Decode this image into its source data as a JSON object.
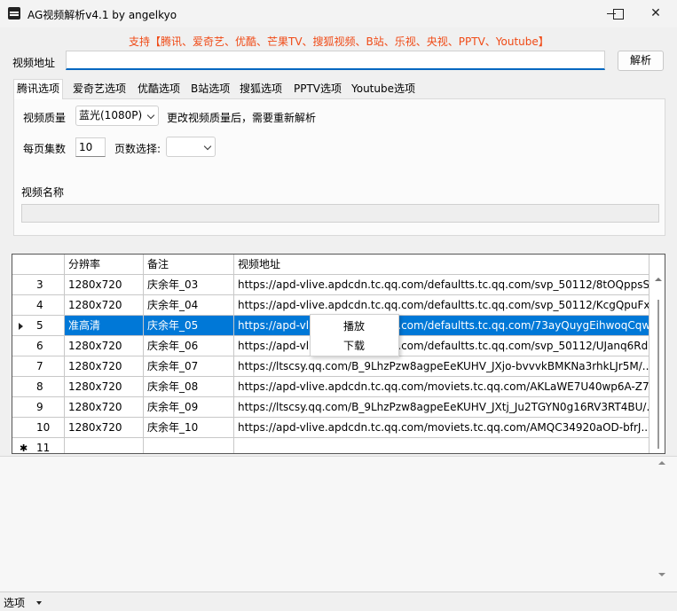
{
  "window": {
    "title": "AG视频解析v4.1 by angelkyo"
  },
  "support_text": "支持【腾讯、爱奇艺、优酷、芒果TV、搜狐视频、B站、乐视、央视、PPTV、Youtube】",
  "url": {
    "label": "视频地址",
    "value": ""
  },
  "parse_button": "解析",
  "tabs": [
    "腾讯选项",
    "爱奇艺选项",
    "优酷选项",
    "B站选项",
    "搜狐选项",
    "PPTV选项",
    "Youtube选项"
  ],
  "options": {
    "quality_label": "视频质量",
    "quality_value": "蓝光(1080P)",
    "quality_note": "更改视频质量后，需要重新解析",
    "per_page_label": "每页集数",
    "per_page_value": "10",
    "page_select_label": "页数选择:",
    "page_select_value": "",
    "name_label": "视频名称",
    "name_value": ""
  },
  "table": {
    "headers": [
      "分辨率",
      "备注",
      "视频地址"
    ],
    "rows": [
      {
        "no": "3",
        "res": "1280x720",
        "note": "庆余年_03",
        "url": "https://apd-vlive.apdcdn.tc.qq.com/defaultts.tc.qq.com/svp_50112/8tOQppsS..."
      },
      {
        "no": "4",
        "res": "1280x720",
        "note": "庆余年_04",
        "url": "https://apd-vlive.apdcdn.tc.qq.com/defaultts.tc.qq.com/svp_50112/KcgQpuFx..."
      },
      {
        "no": "5",
        "res": "准高清",
        "note": "庆余年_05",
        "url": "https://apd-vlive.apdcdn.tc.qq.com/defaultts.tc.qq.com/73ayQuygEihwoqCqw..."
      },
      {
        "no": "6",
        "res": "1280x720",
        "note": "庆余年_06",
        "url": "https://apd-vlive.apdcdn.tc.qq.com/defaultts.tc.qq.com/svp_50112/UJanq6Rd..."
      },
      {
        "no": "7",
        "res": "1280x720",
        "note": "庆余年_07",
        "url": "https://ltscsy.qq.com/B_9LhzPzw8agpeEeKUHV_JXjo-bvvvkBMKNa3rhkLJr5M/..."
      },
      {
        "no": "8",
        "res": "1280x720",
        "note": "庆余年_08",
        "url": "https://apd-vlive.apdcdn.tc.qq.com/moviets.tc.qq.com/AKLaWE7U40wp6A-Z7..."
      },
      {
        "no": "9",
        "res": "1280x720",
        "note": "庆余年_09",
        "url": "https://ltscsy.qq.com/B_9LhzPzw8agpeEeKUHV_JXtj_Ju2TGYN0g16RV3RT4BU/..."
      },
      {
        "no": "10",
        "res": "1280x720",
        "note": "庆余年_10",
        "url": "https://apd-vlive.apdcdn.tc.qq.com/moviets.tc.qq.com/AMQC34920aOD-bfrJ..."
      },
      {
        "no": "11",
        "res": "",
        "note": "",
        "url": ""
      }
    ]
  },
  "context_menu": [
    "播放",
    "下载"
  ],
  "status_menu": "选项",
  "colors": {
    "accent": "#0078d7",
    "support_text": "#f04a16"
  }
}
